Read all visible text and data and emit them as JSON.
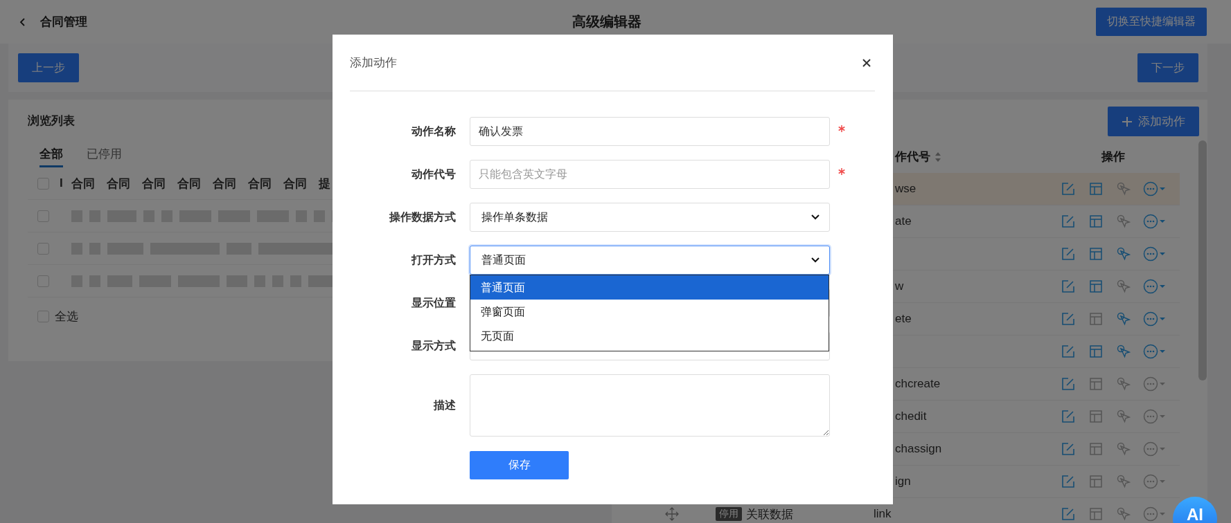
{
  "header": {
    "title": "合同管理",
    "center_title": "高级编辑器",
    "switch_button": "切换至快捷编辑器"
  },
  "toolbar": {
    "prev_button": "上一步",
    "next_button": "下一步"
  },
  "list_card": {
    "title": "浏览列表",
    "tabs": [
      {
        "label": "全部",
        "selected": true
      },
      {
        "label": "已停用",
        "selected": false
      }
    ],
    "columns": [
      "I",
      "合同",
      "合同",
      "合同",
      "合同",
      "合同",
      "合同",
      "合同",
      "提"
    ],
    "header_checked": false,
    "rows": [
      {
        "checked": false
      },
      {
        "checked": false
      },
      {
        "checked": false
      }
    ],
    "select_all": {
      "label": "全选",
      "checked": false
    }
  },
  "actions_panel": {
    "add_button": "添加动作",
    "columns": [
      "作代号",
      "操作"
    ],
    "rows": [
      {
        "kind": "action",
        "code": "wse",
        "selected": true,
        "layout": true,
        "pointer": false,
        "more": true
      },
      {
        "kind": "action",
        "code": "ate",
        "selected": false,
        "layout": true,
        "pointer": false,
        "more": true
      },
      {
        "kind": "action",
        "selected": false,
        "layout": true,
        "pointer": true,
        "more": true
      },
      {
        "kind": "action",
        "code": "w",
        "selected": false,
        "layout": true,
        "pointer": false,
        "more": true
      },
      {
        "kind": "action",
        "code": "ete",
        "selected": false,
        "layout": false,
        "pointer": true,
        "more": true
      },
      {
        "kind": "action",
        "selected": false,
        "layout": true,
        "pointer": true,
        "more": true
      },
      {
        "kind": "action",
        "code": "chcreate",
        "selected": false,
        "layout": false,
        "pointer": false,
        "more": false
      },
      {
        "kind": "action",
        "code": "chedit",
        "selected": false,
        "layout": false,
        "pointer": false,
        "more": false
      },
      {
        "kind": "action",
        "code": "chassign",
        "selected": false,
        "layout": false,
        "pointer": false,
        "more": false
      },
      {
        "kind": "action",
        "code": "ign",
        "selected": false,
        "layout": false,
        "pointer": false,
        "more": false
      },
      {
        "kind": "linked",
        "tag": "停用",
        "name": "关联数据",
        "code": "link",
        "selected": false,
        "layout": false,
        "pointer": false,
        "more": false
      }
    ]
  },
  "dialog": {
    "title": "添加动作",
    "fields": [
      {
        "kind": "input",
        "label": "动作名称",
        "value": "确认发票",
        "required": true
      },
      {
        "kind": "input",
        "label": "动作代号",
        "placeholder": "只能包含英文字母",
        "required": true
      },
      {
        "kind": "select",
        "label": "操作数据方式",
        "value": "操作单条数据",
        "required": false,
        "open": false
      },
      {
        "kind": "select",
        "label": "打开方式",
        "value": "普通页面",
        "required": false,
        "open": true,
        "options": [
          {
            "label": "普通页面",
            "selected": true
          },
          {
            "label": "弹窗页面",
            "selected": false
          },
          {
            "label": "无页面",
            "selected": false
          }
        ]
      },
      {
        "kind": "select",
        "label": "显示位置",
        "required": false,
        "open": false
      },
      {
        "kind": "select",
        "label": "显示方式",
        "required": false,
        "open": false
      },
      {
        "kind": "textarea",
        "label": "描述",
        "required": false
      }
    ],
    "save_button": "保存"
  },
  "ai_button": "AI"
}
